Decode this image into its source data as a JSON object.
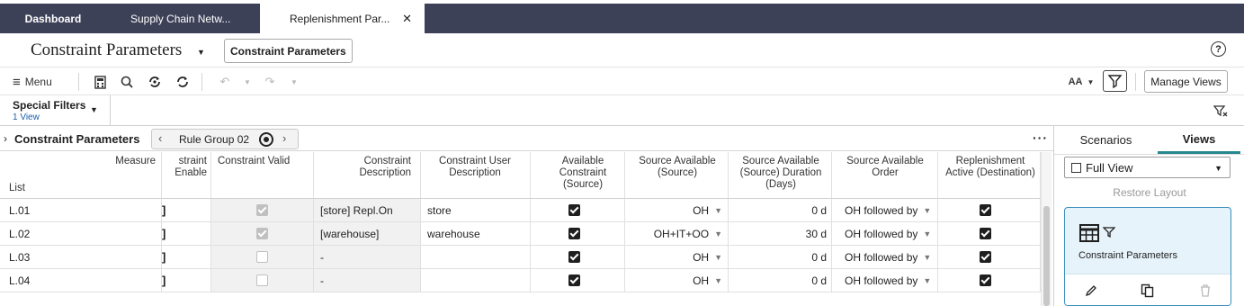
{
  "tabs": [
    {
      "label": "Dashboard"
    },
    {
      "label": "Supply Chain Netw..."
    },
    {
      "label": "Replenishment Par..."
    }
  ],
  "title": {
    "text": "Constraint Parameters",
    "button_label": "Constraint Parameters"
  },
  "toolbar": {
    "menu_label": "Menu",
    "font_size_label": "AA",
    "manage_views_label": "Manage Views"
  },
  "filters": {
    "label": "Special Filters",
    "sublabel": "1 View"
  },
  "breadcrumb": {
    "main": "Constraint Parameters",
    "group": "Rule Group 02"
  },
  "table": {
    "measure_label": "Measure",
    "list_label": "List",
    "headers": [
      "straint Enable",
      "Constraint Valid",
      "Constraint Description",
      "Constraint User Description",
      "Available Constraint (Source)",
      "Source Available (Source)",
      "Source Available (Source) Duration (Days)",
      "Source Available Order",
      "Replenishment Active (Destination)"
    ],
    "rows": [
      {
        "id": "L.01",
        "enable": "]",
        "valid": true,
        "desc": "[store] Repl.On",
        "user_desc": "store",
        "avail": true,
        "source": "OH",
        "duration": "0 d",
        "order": "OH followed by",
        "active": true
      },
      {
        "id": "L.02",
        "enable": "]",
        "valid": true,
        "desc": "[warehouse]",
        "user_desc": "warehouse",
        "avail": true,
        "source": "OH+IT+OO",
        "duration": "30 d",
        "order": "OH followed by",
        "active": true
      },
      {
        "id": "L.03",
        "enable": "]",
        "valid": false,
        "desc": "-",
        "user_desc": "",
        "avail": true,
        "source": "OH",
        "duration": "0 d",
        "order": "OH followed by",
        "active": true
      },
      {
        "id": "L.04",
        "enable": "]",
        "valid": false,
        "desc": "-",
        "user_desc": "",
        "avail": true,
        "source": "OH",
        "duration": "0 d",
        "order": "OH followed by",
        "active": true
      }
    ]
  },
  "panel": {
    "tabs": [
      "Scenarios",
      "Views"
    ],
    "active_tab": "Views",
    "view_select": "Full View",
    "restore_label": "Restore Layout",
    "card_label": "Constraint Parameters"
  },
  "colors": {
    "tab_bg": "#3d4158",
    "accent_teal": "#26878f",
    "card_border": "#3a8fbd",
    "card_bg": "#e6f3fa"
  },
  "icons": [
    "close-icon",
    "help-icon",
    "menu-icon",
    "calculator-icon",
    "search-icon",
    "refresh-icon",
    "undo-icon",
    "redo-icon",
    "filter-icon",
    "clear-filter-icon",
    "more-icon",
    "target-icon",
    "grid-icon",
    "pencil-icon",
    "copy-icon",
    "trash-icon"
  ]
}
